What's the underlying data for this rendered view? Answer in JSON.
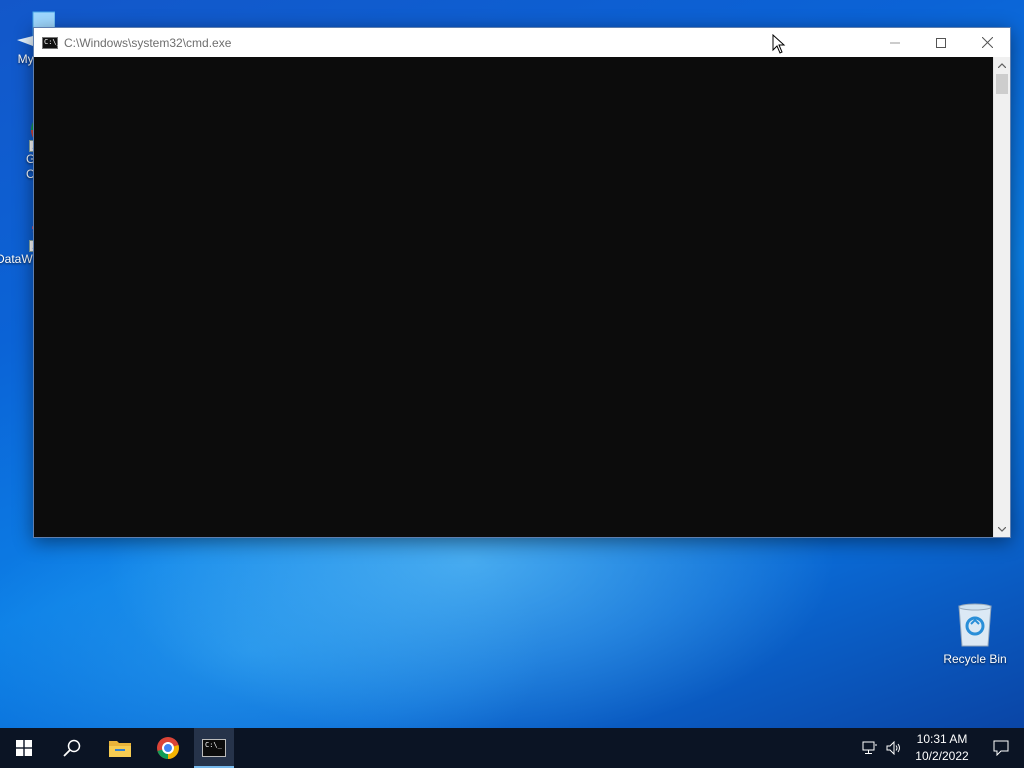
{
  "desktop": {
    "icons": [
      {
        "label": "My Co",
        "icon": "computer-icon"
      },
      {
        "label": "Go\nCh",
        "icon": "chrome-icon"
      },
      {
        "label": "DataW",
        "icon": "datawrangler-icon"
      }
    ],
    "recycle_bin": {
      "label": "Recycle Bin",
      "icon": "recycle-bin-icon"
    }
  },
  "window": {
    "title": "C:\\Windows\\system32\\cmd.exe",
    "title_icon_text": "C:\\_",
    "console_text": "",
    "buttons": [
      "minimize",
      "maximize",
      "close"
    ]
  },
  "taskbar": {
    "items": [
      {
        "name": "start",
        "icon": "windows-logo-icon"
      },
      {
        "name": "search",
        "icon": "search-icon"
      },
      {
        "name": "file-explorer",
        "icon": "folder-icon"
      },
      {
        "name": "chrome",
        "icon": "chrome-icon"
      },
      {
        "name": "cmd",
        "icon": "cmd-icon",
        "active": true
      }
    ],
    "clock": {
      "time": "10:31 AM",
      "date": "10/2/2022"
    },
    "tray": [
      "network-icon",
      "volume-icon",
      "notification-icon"
    ]
  },
  "colors": {
    "accent": "#76b9ed",
    "console_bg": "#0c0c0c",
    "taskbar_bg": "#0b1424"
  }
}
